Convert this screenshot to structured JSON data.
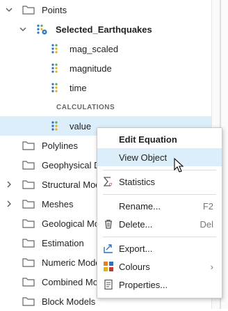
{
  "tree": {
    "points": "Points",
    "selected_earthquakes": "Selected_Earthquakes",
    "attr1": "mag_scaled",
    "attr2": "magnitude",
    "attr3": "time",
    "calc_header": "CALCULATIONS",
    "value": "value",
    "polylines": "Polylines",
    "geophysical": "Geophysical D",
    "structural": "Structural Mode",
    "meshes": "Meshes",
    "geological": "Geological Mode",
    "estimation": "Estimation",
    "numeric": "Numeric Models",
    "combined": "Combined Mod",
    "block": "Block Models"
  },
  "menu": {
    "edit_equation": "Edit Equation",
    "view_object": "View Object",
    "statistics": "Statistics",
    "rename": "Rename...",
    "rename_key": "F2",
    "delete": "Delete...",
    "delete_key": "Del",
    "export": "Export...",
    "colours": "Colours",
    "properties": "Properties..."
  },
  "colors": {
    "selection": "#dbeefa",
    "points_blue": "#2f6fc2",
    "points_yellow": "#e0b21a",
    "points_green": "#5aa35a"
  }
}
